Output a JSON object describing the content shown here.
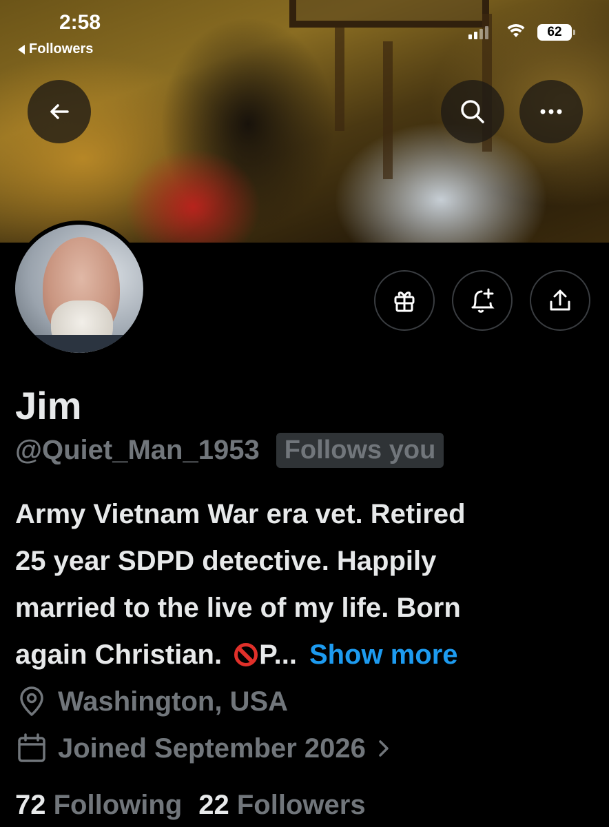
{
  "status_bar": {
    "time": "2:58",
    "back_app_label": "Followers",
    "battery": "62"
  },
  "profile": {
    "name": "Jim",
    "handle": "@Quiet_Man_1953",
    "follows_you_badge": "Follows you",
    "bio_lines": [
      "Army Vietnam War era vet. Retired",
      "25 year SDPD detective. Happily",
      "married to the live of my life. Born",
      "again Christian."
    ],
    "bio_tail": "P...",
    "show_more": "Show more",
    "location": "Washington, USA",
    "joined": "Joined September 2026",
    "following_count": "72",
    "following_label": "Following",
    "followers_count": "22",
    "followers_label": "Followers"
  },
  "icons": {
    "back": "arrow-left-icon",
    "search": "search-icon",
    "more": "more-horizontal-icon",
    "gift": "gift-icon",
    "notify": "bell-plus-icon",
    "share": "share-icon",
    "location": "location-pin-icon",
    "calendar": "calendar-icon"
  },
  "colors": {
    "background": "#000000",
    "text_primary": "#e7e9ea",
    "text_secondary": "#71767b",
    "link": "#1d9bf0"
  }
}
